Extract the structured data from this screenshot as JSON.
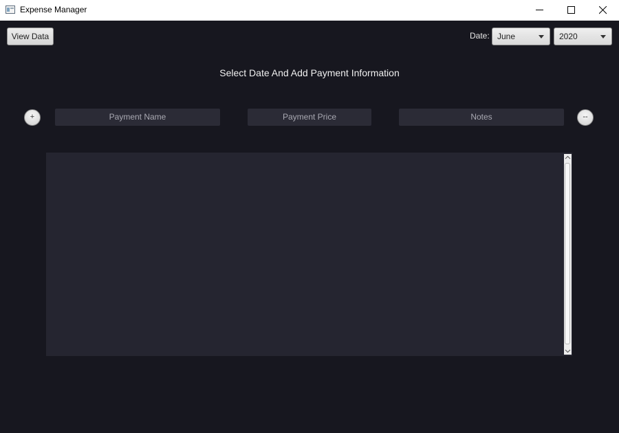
{
  "window": {
    "title": "Expense Manager",
    "app_icon": "window-app-icon"
  },
  "toolbar": {
    "view_data_label": "View Data",
    "date_label": "Date:",
    "month_selected": "June",
    "year_selected": "2020"
  },
  "heading": "Select Date And Add Payment Information",
  "form": {
    "add_label": "+",
    "remove_label": "--",
    "payment_name_placeholder": "Payment Name",
    "payment_price_placeholder": "Payment Price",
    "notes_placeholder": "Notes"
  },
  "payments": [],
  "colors": {
    "background": "#17171f",
    "panel": "#252530",
    "field": "#2b2b36",
    "text": "#f0f0f0"
  }
}
